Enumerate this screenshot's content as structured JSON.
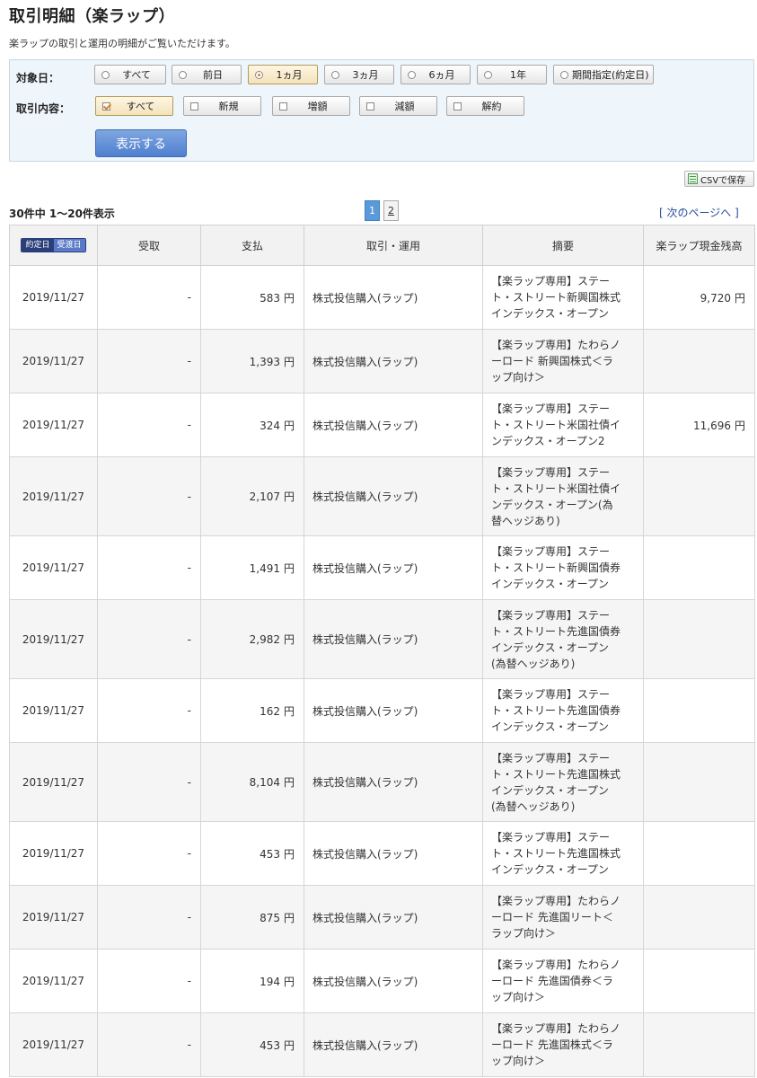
{
  "page": {
    "title": "取引明細（楽ラップ）",
    "description": "楽ラップの取引と運用の明細がご覧いただけます。"
  },
  "filters": {
    "date_label": "対象日：",
    "date_options": [
      {
        "label": "すべて",
        "selected": false
      },
      {
        "label": "前日",
        "selected": false
      },
      {
        "label": "1ヵ月",
        "selected": true
      },
      {
        "label": "3ヵ月",
        "selected": false
      },
      {
        "label": "6ヵ月",
        "selected": false
      },
      {
        "label": "1年",
        "selected": false
      },
      {
        "label": "期間指定(約定日)",
        "selected": false
      }
    ],
    "type_label": "取引内容：",
    "type_options": [
      {
        "label": "すべて",
        "checked": true
      },
      {
        "label": "新規",
        "checked": false
      },
      {
        "label": "増額",
        "checked": false
      },
      {
        "label": "減額",
        "checked": false
      },
      {
        "label": "解約",
        "checked": false
      }
    ],
    "submit_label": "表示する"
  },
  "toolbar": {
    "csv_label": "CSVで保存",
    "count_text": "30件中 1～20件表示",
    "pages": [
      "1",
      "2"
    ],
    "current_page": "1",
    "next_label": "[ 次のページへ ]"
  },
  "table": {
    "date_toggle": [
      "約定日",
      "受渡日"
    ],
    "headers": [
      "受取",
      "支払",
      "取引・運用",
      "摘要",
      "楽ラップ現金残高"
    ],
    "currency_unit": "円",
    "rows": [
      {
        "date": "2019/11/27",
        "recv": "-",
        "pay": "583",
        "type": "株式投信購入(ラップ)",
        "desc": [
          "【楽ラップ専用】ステー",
          "ト・ストリート新興国株式",
          "インデックス・オープン"
        ],
        "balance": "9,720"
      },
      {
        "date": "2019/11/27",
        "recv": "-",
        "pay": "1,393",
        "type": "株式投信購入(ラップ)",
        "desc": [
          "【楽ラップ専用】たわらノ",
          "ーロード 新興国株式＜ラ",
          "ップ向け＞"
        ],
        "balance": ""
      },
      {
        "date": "2019/11/27",
        "recv": "-",
        "pay": "324",
        "type": "株式投信購入(ラップ)",
        "desc": [
          "【楽ラップ専用】ステー",
          "ト・ストリート米国社債イ",
          "ンデックス・オープン2"
        ],
        "balance": "11,696"
      },
      {
        "date": "2019/11/27",
        "recv": "-",
        "pay": "2,107",
        "type": "株式投信購入(ラップ)",
        "desc": [
          "【楽ラップ専用】ステー",
          "ト・ストリート米国社債イ",
          "ンデックス・オープン(為",
          "替ヘッジあり)"
        ],
        "balance": ""
      },
      {
        "date": "2019/11/27",
        "recv": "-",
        "pay": "1,491",
        "type": "株式投信購入(ラップ)",
        "desc": [
          "【楽ラップ専用】ステー",
          "ト・ストリート新興国債券",
          "インデックス・オープン"
        ],
        "balance": ""
      },
      {
        "date": "2019/11/27",
        "recv": "-",
        "pay": "2,982",
        "type": "株式投信購入(ラップ)",
        "desc": [
          "【楽ラップ専用】ステー",
          "ト・ストリート先進国債券",
          "インデックス・オープン",
          "(為替ヘッジあり)"
        ],
        "balance": ""
      },
      {
        "date": "2019/11/27",
        "recv": "-",
        "pay": "162",
        "type": "株式投信購入(ラップ)",
        "desc": [
          "【楽ラップ専用】ステー",
          "ト・ストリート先進国債券",
          "インデックス・オープン"
        ],
        "balance": ""
      },
      {
        "date": "2019/11/27",
        "recv": "-",
        "pay": "8,104",
        "type": "株式投信購入(ラップ)",
        "desc": [
          "【楽ラップ専用】ステー",
          "ト・ストリート先進国株式",
          "インデックス・オープン",
          "(為替ヘッジあり)"
        ],
        "balance": ""
      },
      {
        "date": "2019/11/27",
        "recv": "-",
        "pay": "453",
        "type": "株式投信購入(ラップ)",
        "desc": [
          "【楽ラップ専用】ステー",
          "ト・ストリート先進国株式",
          "インデックス・オープン"
        ],
        "balance": ""
      },
      {
        "date": "2019/11/27",
        "recv": "-",
        "pay": "875",
        "type": "株式投信購入(ラップ)",
        "desc": [
          "【楽ラップ専用】たわらノ",
          "ーロード 先進国リート＜",
          "ラップ向け＞"
        ],
        "balance": ""
      },
      {
        "date": "2019/11/27",
        "recv": "-",
        "pay": "194",
        "type": "株式投信購入(ラップ)",
        "desc": [
          "【楽ラップ専用】たわらノ",
          "ーロード 先進国債券＜ラ",
          "ップ向け＞"
        ],
        "balance": ""
      },
      {
        "date": "2019/11/27",
        "recv": "-",
        "pay": "453",
        "type": "株式投信購入(ラップ)",
        "desc": [
          "【楽ラップ専用】たわらノ",
          "ーロード 先進国株式＜ラ",
          "ップ向け＞"
        ],
        "balance": ""
      }
    ]
  }
}
